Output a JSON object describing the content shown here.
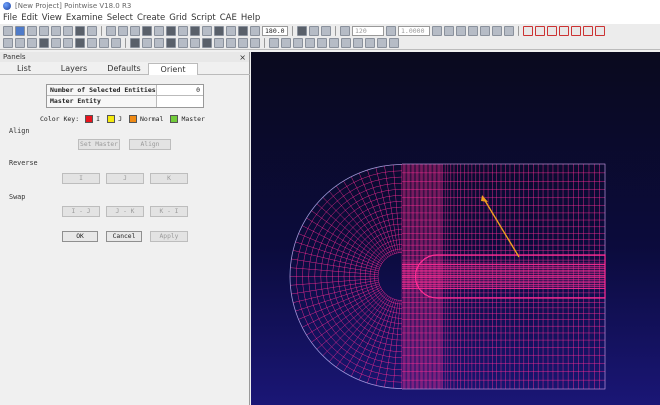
{
  "window": {
    "title": "[New Project] Pointwise V18.0 R3"
  },
  "menu": {
    "items": [
      "File",
      "Edit",
      "View",
      "Examine",
      "Select",
      "Create",
      "Grid",
      "Script",
      "CAE",
      "Help"
    ]
  },
  "toolbar": {
    "zoom_value": "180.0",
    "field_a": "120",
    "field_b": "1.0000"
  },
  "panel": {
    "title": "Panels",
    "close": "×",
    "tabs": [
      "List",
      "Layers",
      "Defaults",
      "Orient"
    ],
    "active_tab": "Orient",
    "entities": {
      "selected_label": "Number of Selected Entities",
      "selected_value": "0",
      "master_label": "Master Entity",
      "master_value": ""
    },
    "color_key": {
      "label": "Color Key:",
      "items": [
        {
          "name": "I",
          "color": "#e8141d"
        },
        {
          "name": "J",
          "color": "#f5ea0d"
        },
        {
          "name": "Normal",
          "color": "#f08a14"
        },
        {
          "name": "Master",
          "color": "#72cc3a"
        }
      ]
    },
    "align": {
      "title": "Align",
      "set_master": "Set Master",
      "align": "Align"
    },
    "reverse": {
      "title": "Reverse",
      "i": "I",
      "j": "J",
      "k": "K"
    },
    "swap": {
      "title": "Swap",
      "ij": "I - J",
      "jk": "J - K",
      "ki": "K - I"
    },
    "actions": {
      "ok": "OK",
      "cancel": "Cancel",
      "apply": "Apply"
    }
  },
  "viewport": {
    "background_top": "#0a0a1e",
    "background_bottom": "#1a1676",
    "mesh_color": "#ff2d95",
    "vector_color": "#f0a020"
  }
}
